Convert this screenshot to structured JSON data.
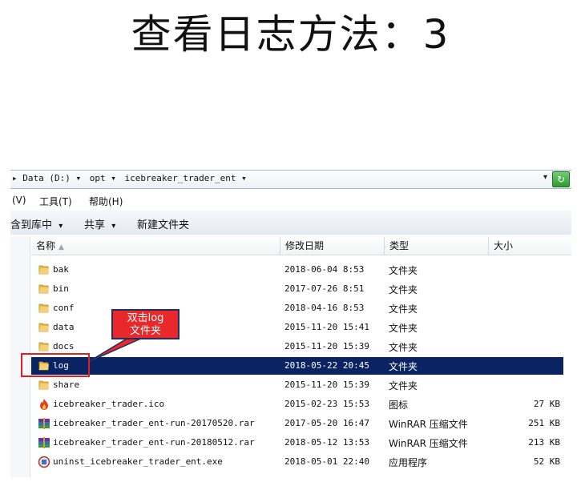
{
  "slide": {
    "title": "查看日志方法：3"
  },
  "address_bar": {
    "crumbs": [
      "▸ Data (D:) ▾",
      "opt ▾",
      "icebreaker_trader_ent ▾"
    ],
    "dropdown_arrow": "▾",
    "refresh_icon": "↻"
  },
  "menu": {
    "items": [
      "(V)",
      "工具(T)",
      "帮助(H)"
    ]
  },
  "command_bar": {
    "include_library": "含到库中",
    "share": "共享",
    "new_folder": "新建文件夹",
    "caret": "▾"
  },
  "columns": {
    "name": "名称",
    "modified": "修改日期",
    "type": "类型",
    "size": "大小"
  },
  "files": [
    {
      "name": "bak",
      "date": "2018-06-04 8:53",
      "type": "文件夹",
      "size": "",
      "icon": "folder-icon"
    },
    {
      "name": "bin",
      "date": "2017-07-26 8:51",
      "type": "文件夹",
      "size": "",
      "icon": "folder-icon"
    },
    {
      "name": "conf",
      "date": "2018-04-16 8:53",
      "type": "文件夹",
      "size": "",
      "icon": "folder-icon"
    },
    {
      "name": "data",
      "date": "2015-11-20 15:41",
      "type": "文件夹",
      "size": "",
      "icon": "folder-icon"
    },
    {
      "name": "docs",
      "date": "2015-11-20 15:39",
      "type": "文件夹",
      "size": "",
      "icon": "folder-icon"
    },
    {
      "name": "log",
      "date": "2018-05-22 20:45",
      "type": "文件夹",
      "size": "",
      "icon": "folder-icon",
      "selected": true
    },
    {
      "name": "share",
      "date": "2015-11-20 15:39",
      "type": "文件夹",
      "size": "",
      "icon": "folder-icon"
    },
    {
      "name": "icebreaker_trader.ico",
      "date": "2015-02-23 15:53",
      "type": "图标",
      "size": "27 KB",
      "icon": "flame-icon"
    },
    {
      "name": "icebreaker_trader_ent-run-20170520.rar",
      "date": "2017-05-20 16:47",
      "type": "WinRAR 压缩文件",
      "size": "251 KB",
      "icon": "winrar-icon"
    },
    {
      "name": "icebreaker_trader_ent-run-20180512.rar",
      "date": "2018-05-12 13:53",
      "type": "WinRAR 压缩文件",
      "size": "213 KB",
      "icon": "winrar-icon"
    },
    {
      "name": "uninst_icebreaker_trader_ent.exe",
      "date": "2018-05-01 22:40",
      "type": "应用程序",
      "size": "52 KB",
      "icon": "installer-icon"
    }
  ],
  "annotation": {
    "line1": "双击log",
    "line2": "文件夹"
  },
  "colors": {
    "selection": "#0a2463",
    "callout": "#e8282a",
    "highlight": "#e02020"
  }
}
